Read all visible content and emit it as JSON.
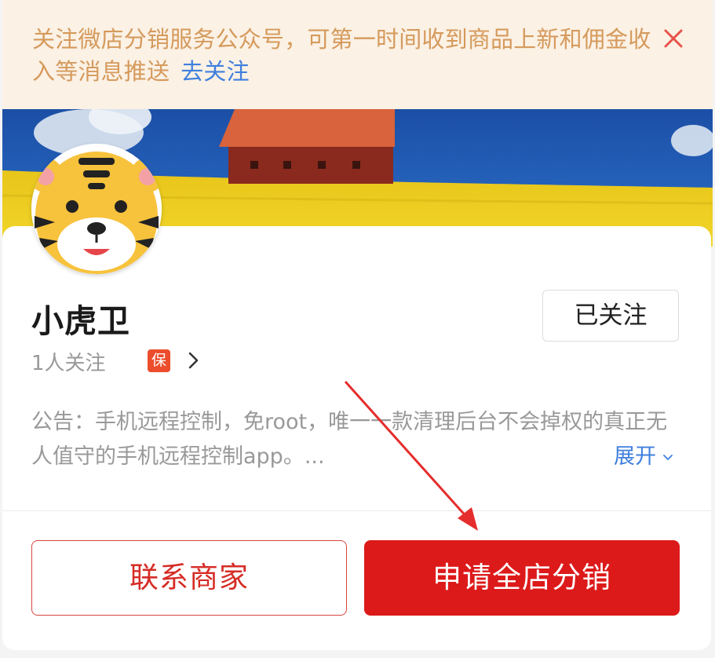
{
  "notice": {
    "text": "关注微店分销服务公众号，可第一时间收到商品上新和佣金收入等消息推送",
    "link_label": "去关注",
    "close_icon": "close-icon",
    "colors": {
      "background": "#fbf1e5",
      "text": "#d59a5c",
      "link": "#3f7fde",
      "close": "#e8524a"
    }
  },
  "shop": {
    "name": "小虎卫",
    "followers": "1人关注",
    "guarantee_badge": "保",
    "follow_button_label": "已关注",
    "announcement": "公告：手机远程控制，免root，唯一一款清理后台不会掉权的真正无人值守的手机远程控制app。...",
    "expand_label": "展开"
  },
  "actions": {
    "contact_label": "联系商家",
    "apply_label": "申请全店分销",
    "colors": {
      "primary": "#dd1a1a",
      "outline": "#d8453f"
    }
  },
  "annotation": {
    "type": "red-arrow"
  }
}
